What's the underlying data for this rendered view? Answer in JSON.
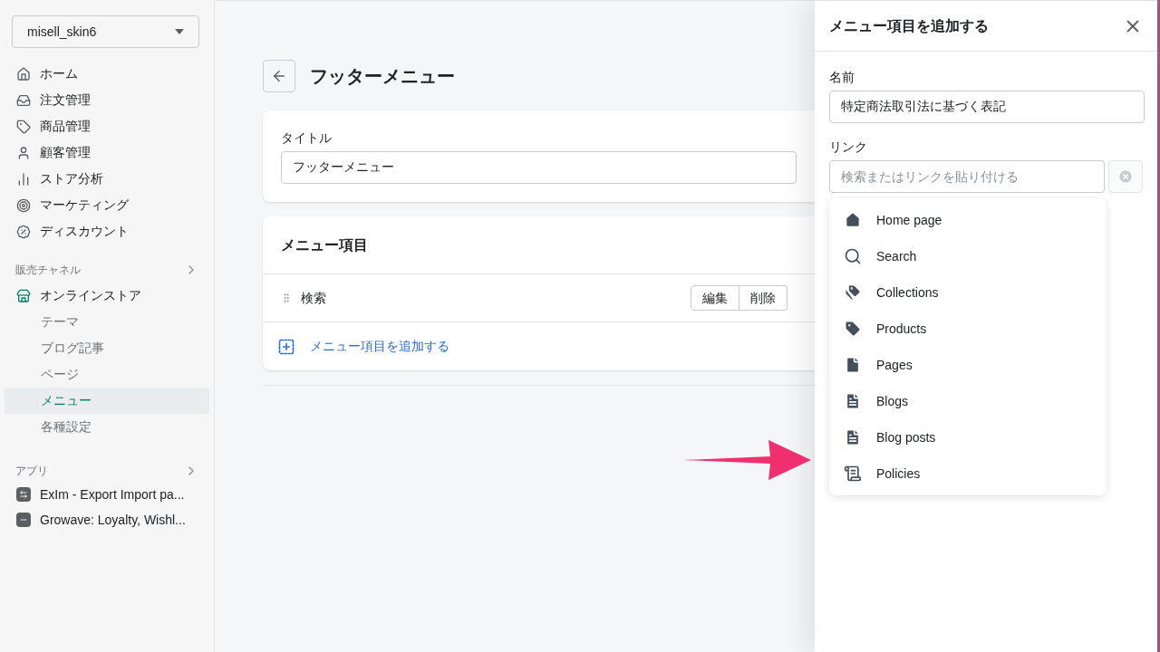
{
  "store_selector": {
    "value": "misell_skin6"
  },
  "nav": [
    {
      "label": "ホーム",
      "kind": "home"
    },
    {
      "label": "注文管理",
      "kind": "orders"
    },
    {
      "label": "商品管理",
      "kind": "products"
    },
    {
      "label": "顧客管理",
      "kind": "customers"
    },
    {
      "label": "ストア分析",
      "kind": "analytics"
    },
    {
      "label": "マーケティング",
      "kind": "marketing"
    },
    {
      "label": "ディスカウント",
      "kind": "discounts"
    }
  ],
  "sales_channels": {
    "heading": "販売チャネル",
    "channel": "オンラインストア",
    "items": [
      {
        "label": "テーマ",
        "selected": false
      },
      {
        "label": "ブログ記事",
        "selected": false
      },
      {
        "label": "ページ",
        "selected": false
      },
      {
        "label": "メニュー",
        "selected": true
      },
      {
        "label": "各種設定",
        "selected": false
      }
    ]
  },
  "apps": {
    "heading": "アプリ",
    "items": [
      {
        "label": "ExIm - Export Import pa...",
        "kind": "arrows"
      },
      {
        "label": "Growave: Loyalty, Wishl...",
        "kind": "dashes"
      }
    ]
  },
  "page": {
    "title": "フッターメニュー",
    "title_card": {
      "label": "タイトル",
      "value": "フッターメニュー"
    },
    "menu_items_card": {
      "heading": "メニュー項目",
      "items": [
        {
          "label": "検索",
          "edit": "編集",
          "delete": "削除"
        }
      ],
      "add_link": "メニュー項目を追加する"
    }
  },
  "panel": {
    "title": "メニュー項目を追加する",
    "name_label": "名前",
    "name_value": "特定商法取引法に基づく表記",
    "link_label": "リンク",
    "link_placeholder": "検索またはリンクを貼り付ける",
    "options": [
      {
        "label": "Home page",
        "kind": "home"
      },
      {
        "label": "Search",
        "kind": "search"
      },
      {
        "label": "Collections",
        "kind": "collections"
      },
      {
        "label": "Products",
        "kind": "products"
      },
      {
        "label": "Pages",
        "kind": "pages"
      },
      {
        "label": "Blogs",
        "kind": "blogs"
      },
      {
        "label": "Blog posts",
        "kind": "blogs"
      },
      {
        "label": "Policies",
        "kind": "policies"
      }
    ]
  }
}
